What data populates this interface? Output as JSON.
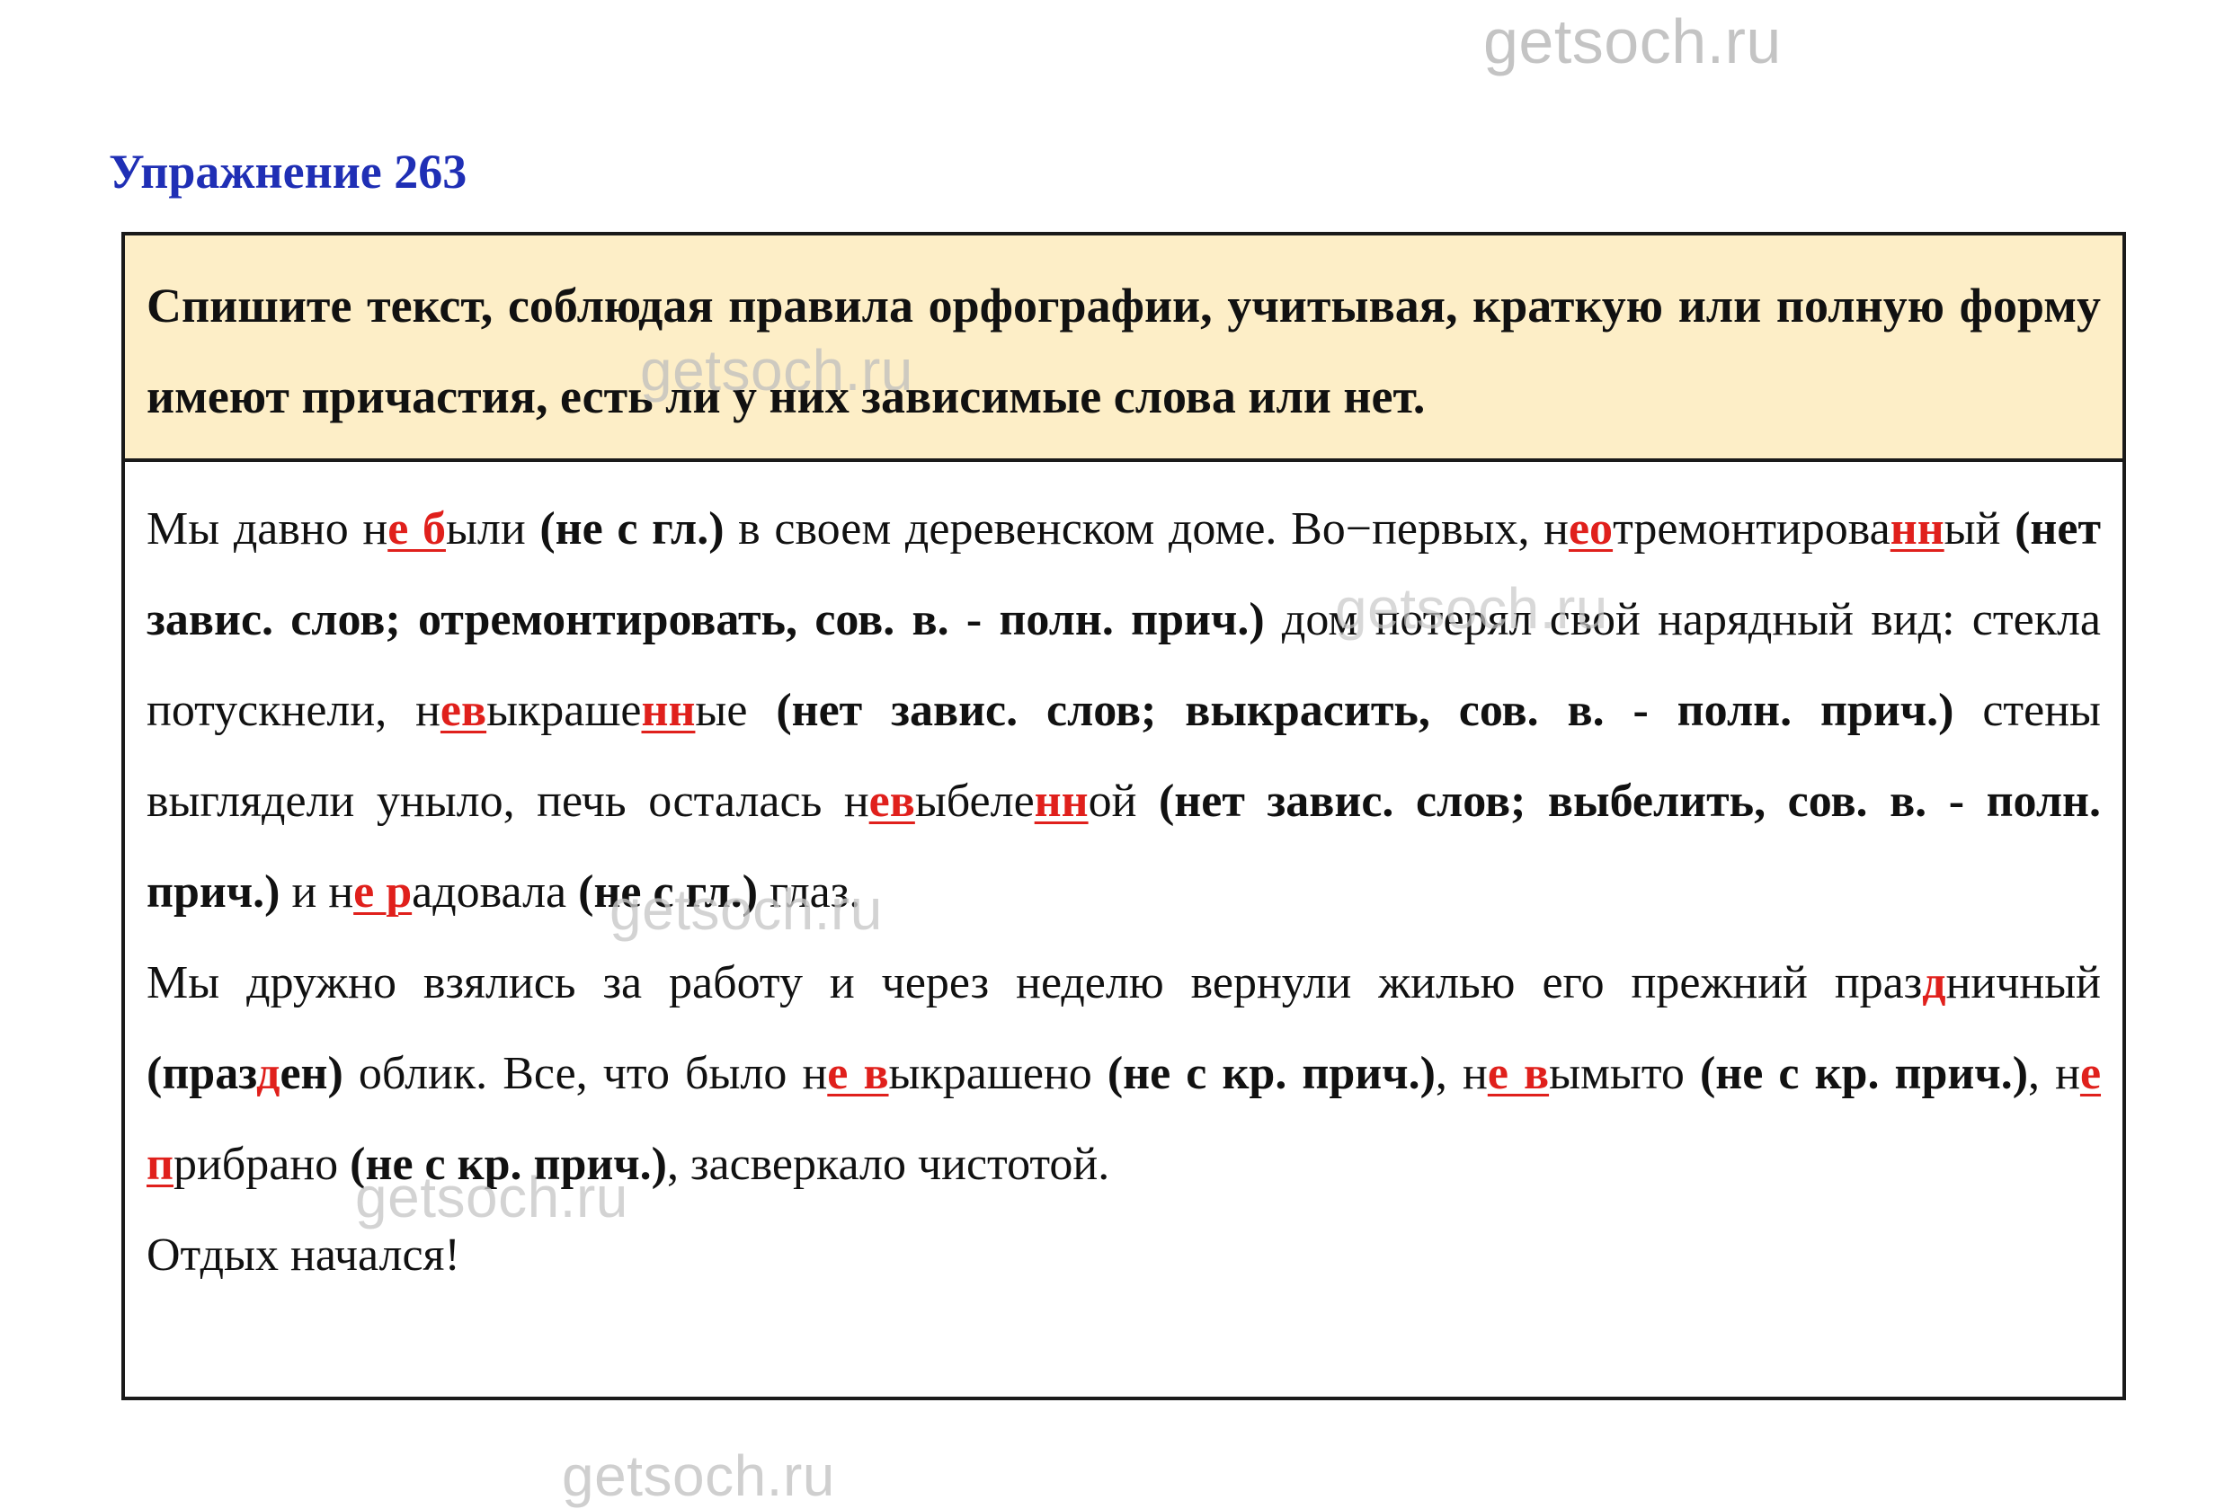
{
  "watermark": "getsoch.ru",
  "title": "Упражнение 263",
  "task": "Спишите текст, соблюдая правила орфографии, учитывая, краткую или полную форму имеют причастия, есть ли у них зависимые слова или нет.",
  "paragraphs": [
    [
      {
        "t": "Мы давно н",
        "s": "n"
      },
      {
        "t": "е б",
        "s": "r"
      },
      {
        "t": "ыли ",
        "s": "n"
      },
      {
        "t": "(не с гл.)",
        "s": "b"
      },
      {
        "t": " в своем деревенском доме. Во−первых, н",
        "s": "n"
      },
      {
        "t": "ео",
        "s": "r"
      },
      {
        "t": "тремонтирова",
        "s": "n"
      },
      {
        "t": "нн",
        "s": "r"
      },
      {
        "t": "ый ",
        "s": "n"
      },
      {
        "t": "(нет завис. слов; отремонтировать, сов. в. - полн. прич.)",
        "s": "b"
      },
      {
        "t": " дом потерял свой нарядный вид: стекла потускнели, н",
        "s": "n"
      },
      {
        "t": "ев",
        "s": "r"
      },
      {
        "t": "ыкраше",
        "s": "n"
      },
      {
        "t": "нн",
        "s": "r"
      },
      {
        "t": "ые ",
        "s": "n"
      },
      {
        "t": "(нет завис. слов; выкрасить, сов. в. - полн. прич.)",
        "s": "b"
      },
      {
        "t": " стены выглядели уныло, печь осталась н",
        "s": "n"
      },
      {
        "t": "ев",
        "s": "r"
      },
      {
        "t": "ыбеле",
        "s": "n"
      },
      {
        "t": "нн",
        "s": "r"
      },
      {
        "t": "ой ",
        "s": "n"
      },
      {
        "t": "(нет завис. слов; выбелить, сов. в. - полн. прич.)",
        "s": "b"
      },
      {
        "t": " и н",
        "s": "n"
      },
      {
        "t": "е р",
        "s": "r"
      },
      {
        "t": "адовала ",
        "s": "n"
      },
      {
        "t": "(не с гл.)",
        "s": "b"
      },
      {
        "t": " глаз.",
        "s": "n"
      }
    ],
    [
      {
        "t": "Мы дружно взялись за работу и через неделю вернули жилью его прежний праз",
        "s": "n"
      },
      {
        "t": "д",
        "s": "r"
      },
      {
        "t": "ничный ",
        "s": "n"
      },
      {
        "t": "(праз",
        "s": "b"
      },
      {
        "t": "д",
        "s": "r"
      },
      {
        "t": "ен)",
        "s": "b"
      },
      {
        "t": " облик. Все, что было н",
        "s": "n"
      },
      {
        "t": "е в",
        "s": "r"
      },
      {
        "t": "ыкрашено ",
        "s": "n"
      },
      {
        "t": "(не с кр. прич.)",
        "s": "b"
      },
      {
        "t": ", н",
        "s": "n"
      },
      {
        "t": "е в",
        "s": "r"
      },
      {
        "t": "ымыто ",
        "s": "n"
      },
      {
        "t": "(не с кр. прич.)",
        "s": "b"
      },
      {
        "t": ", н",
        "s": "n"
      },
      {
        "t": "е п",
        "s": "r"
      },
      {
        "t": "рибрано ",
        "s": "n"
      },
      {
        "t": "(не с кр. прич.)",
        "s": "b"
      },
      {
        "t": ", засверкало чистотой.",
        "s": "n"
      }
    ],
    [
      {
        "t": "Отдых начался!",
        "s": "n"
      }
    ]
  ],
  "colors": {
    "title": "#1f2fb5",
    "highlight": "#e0201c",
    "task_bg": "#fdeec7"
  }
}
